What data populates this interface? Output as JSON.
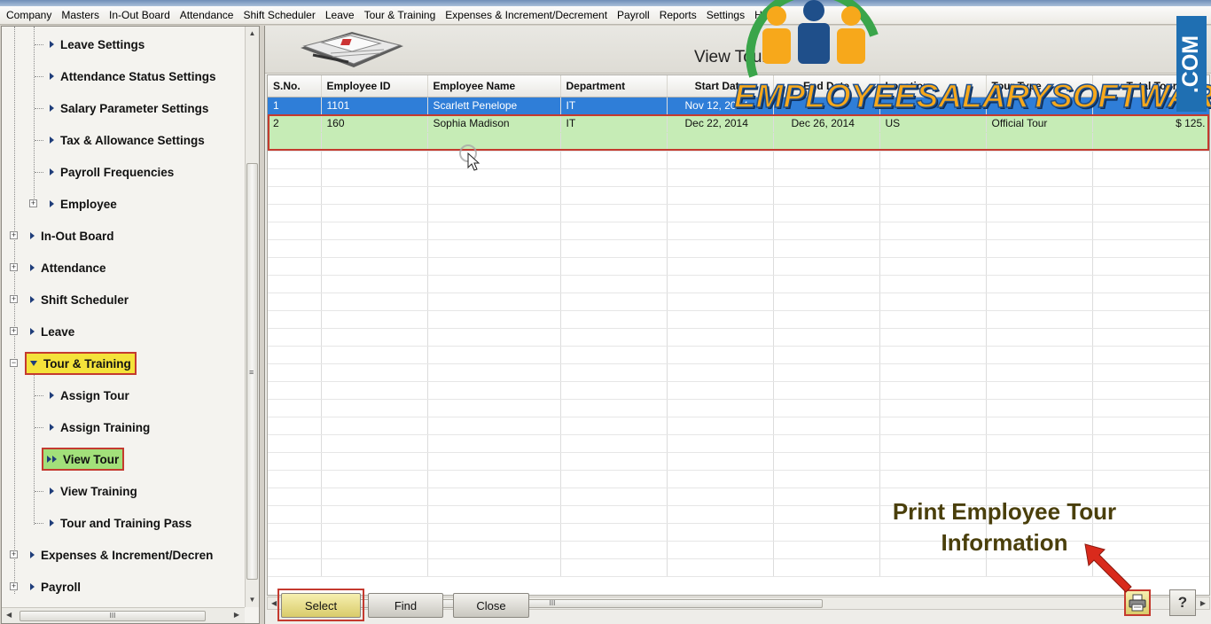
{
  "menu": [
    "Company",
    "Masters",
    "In-Out Board",
    "Attendance",
    "Shift Scheduler",
    "Leave",
    "Tour & Training",
    "Expenses & Increment/Decrement",
    "Payroll",
    "Reports",
    "Settings",
    "Help"
  ],
  "sidebar": {
    "leave_settings": "Leave Settings",
    "attendance_status_settings": "Attendance Status Settings",
    "salary_parameter_settings": "Salary Parameter Settings",
    "tax_allowance_settings": "Tax & Allowance Settings",
    "payroll_frequencies": "Payroll Frequencies",
    "employee": "Employee",
    "in_out_board": "In-Out Board",
    "attendance": "Attendance",
    "shift_scheduler": "Shift Scheduler",
    "leave": "Leave",
    "tour_training": "Tour & Training",
    "assign_tour": "Assign Tour",
    "assign_training": "Assign Training",
    "view_tour": "View Tour",
    "view_training": "View Training",
    "tour_training_pass": "Tour and Training Pass",
    "expenses": "Expenses & Increment/Decren",
    "payroll": "Payroll"
  },
  "main": {
    "title": "View Tour",
    "columns": [
      "S.No.",
      "Employee ID",
      "Employee Name",
      "Department",
      "Start Date",
      "End Date",
      "Location",
      "Tour Type",
      "Total Tour"
    ],
    "rows": [
      {
        "sno": "1",
        "id": "1101",
        "name": "Scarlett Penelope",
        "dept": "IT",
        "start": "Nov 12, 2014",
        "end": "",
        "loc": "",
        "type": "",
        "total": ""
      },
      {
        "sno": "2",
        "id": "160",
        "name": "Sophia Madison",
        "dept": "IT",
        "start": "Dec 22, 2014",
        "end": "Dec 26, 2014",
        "loc": "US",
        "type": "Official Tour",
        "total": "$ 125."
      }
    ],
    "buttons": {
      "select": "Select",
      "find": "Find",
      "close": "Close"
    },
    "help": "?"
  },
  "annotation": {
    "line1": "Print Employee Tour",
    "line2": "Information"
  },
  "watermark": {
    "text": "EMPLOYEESALARYSOFTWARE",
    "suffix": ".COM"
  },
  "colors": {
    "highlight_yellow": "#f4e23a",
    "highlight_green": "#a2e07a",
    "selection_blue": "#2f7ed8",
    "row_green": "#c6ecb6",
    "outline_red": "#c43a2f"
  }
}
